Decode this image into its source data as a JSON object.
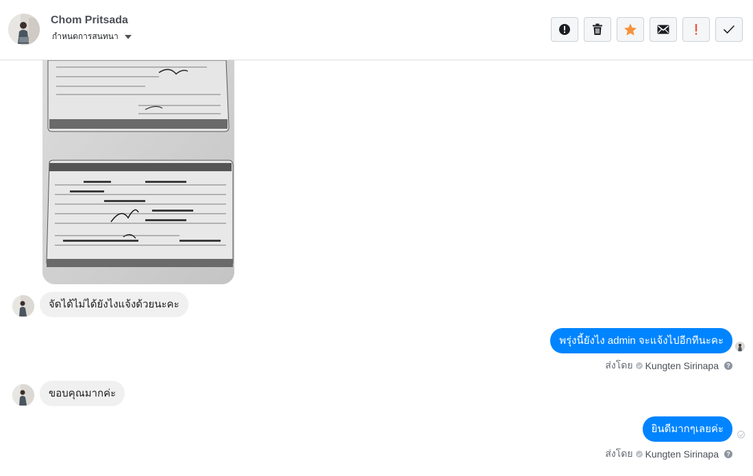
{
  "header": {
    "contact_name": "Chom Pritsada",
    "label_dropdown": "กำหนดการสนทนา",
    "actions": [
      {
        "name": "mark-spam-button",
        "icon": "alert-circle-icon"
      },
      {
        "name": "delete-button",
        "icon": "trash-icon"
      },
      {
        "name": "star-button",
        "icon": "star-icon",
        "color": "#f7923b"
      },
      {
        "name": "mark-unread-button",
        "icon": "envelope-icon"
      },
      {
        "name": "follow-up-button",
        "icon": "exclamation-icon",
        "color": "#e9573e"
      },
      {
        "name": "done-button",
        "icon": "check-icon"
      }
    ]
  },
  "messages": {
    "incoming_1": "จัดได้ไม่ได้ยังไงแจ้งด้วยนะคะ",
    "outgoing_1": "พรุ่งนี้ยังไง admin จะแจ้งไปอีกทีนะคะ",
    "incoming_2": "ขอบคุณมากค่ะ",
    "outgoing_2": "ยินดีมากๆเลยค่ะ"
  },
  "sent_by": {
    "prefix": "ส่งโดย",
    "agent": "Kungten Sirinapa"
  },
  "colors": {
    "outgoing_bubble": "#0084ff",
    "incoming_bubble": "#f1f0f0"
  }
}
